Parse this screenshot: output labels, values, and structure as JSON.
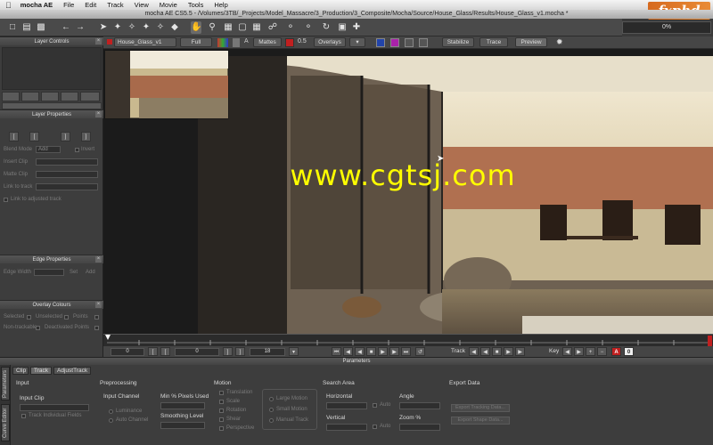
{
  "menubar": {
    "app_name": "mocha AE",
    "items": [
      "File",
      "Edit",
      "Track",
      "View",
      "Movie",
      "Tools",
      "Help"
    ]
  },
  "window": {
    "title": "mocha AE CS5.5 - /Volumes/3TB/_Projects/Model_Massacre/3_Production/3_Composite/Mocha/Source/House_Glass/Results/House_Glass_v1.mocha *"
  },
  "progress": {
    "label": "0%",
    "value": 0
  },
  "logo_text": "fxphd",
  "watermark_text": "www.cgtsj.com",
  "view_toolbar": {
    "layer_select": "House_Glass_v1",
    "quality": "Full",
    "a_label": "A",
    "mattes": "Mattes",
    "opacity": "0.5",
    "overlays": "Overlays",
    "stabilize": "Stabilize",
    "trace": "Trace",
    "preview": "Preview"
  },
  "left_panel": {
    "layer_controls": "Layer Controls",
    "layer_properties": "Layer Properties",
    "props": [
      "Blend Mode",
      "Insert Clip",
      "Matte Clip",
      "Link to track"
    ],
    "blend_value": "Add",
    "invert": "Invert",
    "link_adjusted": "Link to adjusted track",
    "edge_properties": "Edge Properties",
    "edge_width": "Edge Width",
    "set": "Set",
    "add": "Add",
    "overlay_colours": "Overlay Colours",
    "overlay_items": [
      "Selected",
      "Unselected",
      "Points",
      "Non-trackable",
      "Deactivated Points"
    ]
  },
  "transport": {
    "in_frame": "0",
    "current_frame": "0",
    "out_frame": "18",
    "track_label": "Track",
    "key_label": "Key"
  },
  "parameters": {
    "header": "Parameters",
    "side_tabs": [
      "Parameters",
      "Curve Editor"
    ],
    "tabs": [
      "Clip",
      "Track",
      "AdjustTrack"
    ],
    "active_tab": "Track",
    "input": {
      "title": "Input",
      "input_clip": "Input Clip",
      "track_individual": "Track Individual Fields"
    },
    "preprocessing": {
      "title": "Preprocessing",
      "input_channel": "Input Channel",
      "luminance": "Luminance",
      "auto_channel": "Auto Channel",
      "min_pixels": "Min % Pixels Used",
      "smoothing": "Smoothing Level"
    },
    "motion": {
      "title": "Motion",
      "options": [
        "Translation",
        "Scale",
        "Rotation",
        "Shear",
        "Perspective"
      ],
      "modes": [
        "Large Motion",
        "Small Motion",
        "Manual Track"
      ]
    },
    "search_area": {
      "title": "Search Area",
      "horizontal": "Horizontal",
      "vertical": "Vertical",
      "auto": "Auto",
      "angle": "Angle",
      "zoom": "Zoom %"
    },
    "export_data": {
      "title": "Export Data",
      "tracking_data": "Export Tracking Data...",
      "shape_data": "Export Shape Data..."
    }
  },
  "colors": {
    "panel": "#3d3d3d",
    "viewer": "#1b1b1b",
    "accent_red": "#c02020",
    "watermark": "#ffff00"
  }
}
